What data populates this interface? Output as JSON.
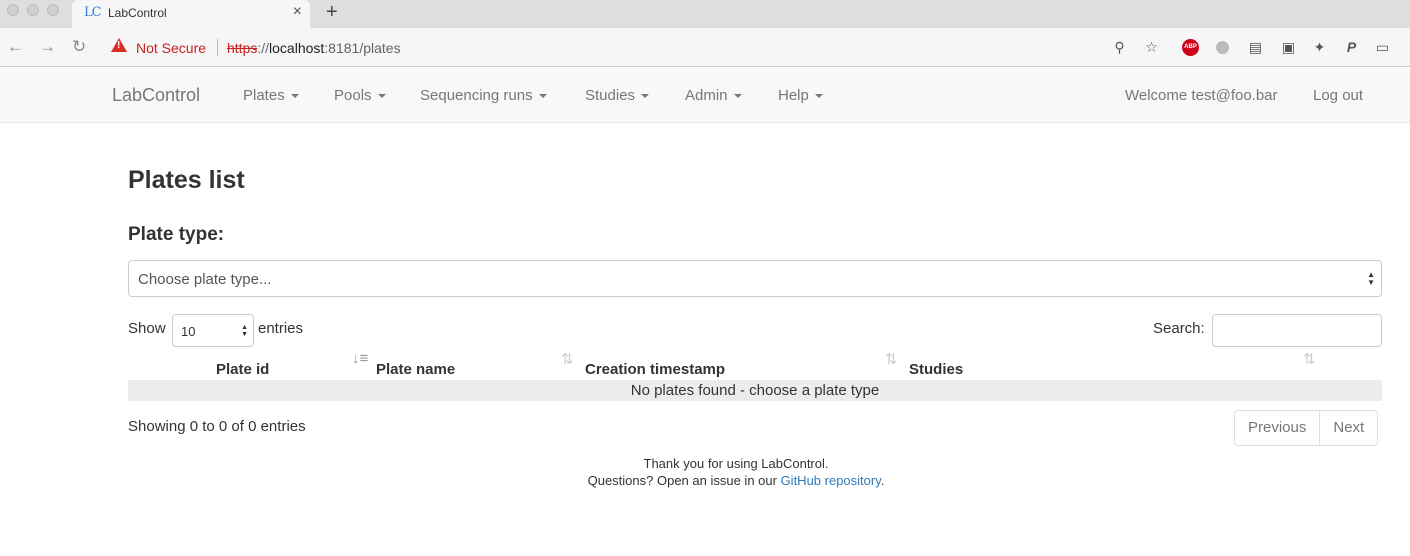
{
  "browser": {
    "tab_favicon": "LC",
    "tab_title": "LabControl",
    "tab_close": "×",
    "new_tab": "+",
    "security_label": "Not Secure",
    "url_scheme": "https",
    "url_sep": "://",
    "url_host": "localhost",
    "url_rest": ":8181/plates",
    "icons": [
      "back-icon",
      "forward-icon",
      "reload-icon",
      "warning-icon",
      "zoom-icon",
      "star-icon",
      "adblock-icon",
      "extension-icon",
      "cast-icon"
    ],
    "abp_label": "ABP",
    "security_color": "#c5221f"
  },
  "navbar": {
    "brand": "LabControl",
    "menus": [
      {
        "label": "Plates"
      },
      {
        "label": "Pools"
      },
      {
        "label": "Sequencing runs"
      },
      {
        "label": "Studies"
      },
      {
        "label": "Admin"
      },
      {
        "label": "Help"
      }
    ],
    "welcome": "Welcome test@foo.bar",
    "logout": "Log out"
  },
  "page": {
    "title": "Plates list",
    "plate_type_label": "Plate type:",
    "plate_type_placeholder": "Choose plate type..."
  },
  "table": {
    "show_label": "Show",
    "page_length": "10",
    "entries_label": "entries",
    "search_label": "Search:",
    "search_value": "",
    "columns": [
      {
        "label": "Plate id"
      },
      {
        "label": "Plate name"
      },
      {
        "label": "Creation timestamp"
      },
      {
        "label": "Studies"
      }
    ],
    "empty_message": "No plates found - choose a plate type",
    "info": "Showing 0 to 0 of 0 entries",
    "previous_label": "Previous",
    "next_label": "Next"
  },
  "footer": {
    "line1": "Thank you for using LabControl.",
    "line2_prefix": "Questions? Open an issue in our ",
    "link_text": "GitHub repository",
    "line2_suffix": ".",
    "link_color": "#337ab7"
  }
}
